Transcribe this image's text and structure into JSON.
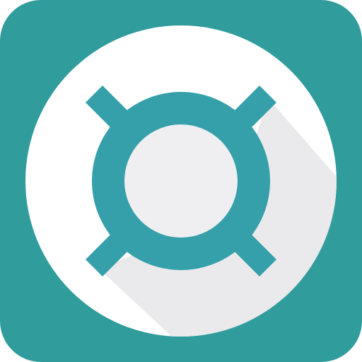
{
  "app_icon": {
    "icon_name": "currency-sign-icon",
    "colors": {
      "tile": "#319C9C",
      "disc": "#FFFFFF",
      "shadow": "#EAEAEC",
      "glyph": "#35A0AA",
      "glyph_fill": "#EFEFF1"
    }
  }
}
